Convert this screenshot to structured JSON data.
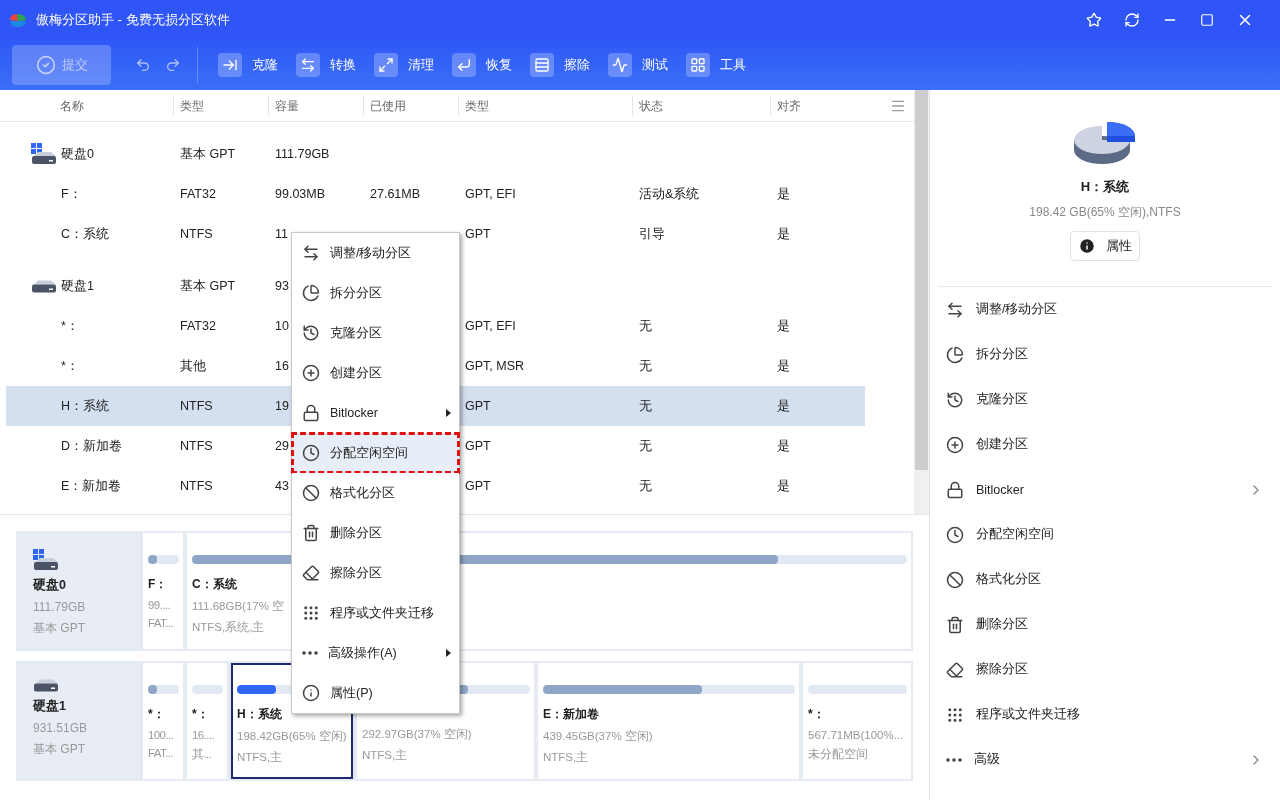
{
  "window": {
    "title": "傲梅分区助手 - 免费无损分区软件"
  },
  "toolbar": {
    "submit": {
      "label": "提交",
      "disabled": true
    },
    "tools": [
      {
        "label": "克隆"
      },
      {
        "label": "转换"
      },
      {
        "label": "清理"
      },
      {
        "label": "恢复"
      },
      {
        "label": "擦除"
      },
      {
        "label": "测试"
      },
      {
        "label": "工具"
      }
    ]
  },
  "table": {
    "columns": [
      "名称",
      "类型",
      "容量",
      "已使用",
      "类型",
      "状态",
      "对齐"
    ],
    "disks": [
      {
        "name": "硬盘0",
        "type": "基本 GPT",
        "capacity": "111.79GB",
        "system": true,
        "children": [
          {
            "name": "F：",
            "type": "FAT32",
            "capacity": "99.03MB",
            "used": "27.61MB",
            "fs": "GPT, EFI",
            "status": "活动&系统",
            "align": "是",
            "selected": false
          },
          {
            "name": "C：系统",
            "type": "NTFS",
            "capacity": "11",
            "fs": "GPT",
            "status": "引导",
            "align": "是",
            "selected": false
          }
        ]
      },
      {
        "name": "硬盘1",
        "type": "基本 GPT",
        "capacity": "93",
        "system": false,
        "children": [
          {
            "name": "*：",
            "type": "FAT32",
            "capacity": "10",
            "fs": "GPT, EFI",
            "status": "无",
            "align": "是",
            "selected": false
          },
          {
            "name": "*：",
            "type": "其他",
            "capacity": "16",
            "fs": "GPT, MSR",
            "status": "无",
            "align": "是",
            "selected": false
          },
          {
            "name": "H：系统",
            "type": "NTFS",
            "capacity": "19",
            "fs": "GPT",
            "status": "无",
            "align": "是",
            "selected": true
          },
          {
            "name": "D：新加卷",
            "type": "NTFS",
            "capacity": "29",
            "fs": "GPT",
            "status": "无",
            "align": "是",
            "selected": false
          },
          {
            "name": "E：新加卷",
            "type": "NTFS",
            "capacity": "43",
            "fs": "GPT",
            "status": "无",
            "align": "是",
            "selected": false
          }
        ]
      }
    ]
  },
  "disk_map": [
    {
      "name": "硬盘0",
      "size": "111.79GB",
      "type": "基本 GPT",
      "system": true,
      "partitions": [
        {
          "label": "F：",
          "size": "99....",
          "fs": "FAT...",
          "level": 0.28,
          "selected": false
        },
        {
          "label": "C：系统",
          "size": "111.68GB(17% 空",
          "fs": "NTFS,系统,主",
          "level": 0.82,
          "selected": false
        }
      ]
    },
    {
      "name": "硬盘1",
      "size": "931.51GB",
      "type": "基本 GPT",
      "system": false,
      "partitions": [
        {
          "label": "*：",
          "size": "100...",
          "fs": "FAT...",
          "level": 0.28,
          "selected": false
        },
        {
          "label": "*：",
          "size": "16....",
          "fs": "其...",
          "level": 0,
          "selected": false
        },
        {
          "label": "H：系统",
          "size": "198.42GB(65% 空闲)",
          "fs": "NTFS,主",
          "level": 0.35,
          "selected": true
        },
        {
          "size": "292.97GB(37% 空闲)",
          "fs": "NTFS,主",
          "level": 0.63,
          "selected": false
        },
        {
          "label": "E：新加卷",
          "size": "439.45GB(37% 空闲)",
          "fs": "NTFS,主",
          "level": 0.63,
          "selected": false
        },
        {
          "label": "*：",
          "size": "567.71MB(100%...",
          "fs": "未分配空间",
          "level": 0,
          "selected": false
        }
      ]
    }
  ],
  "context_menu": [
    {
      "label": "调整/移动分区",
      "submenu": false,
      "selected": false
    },
    {
      "label": "拆分分区",
      "submenu": false,
      "selected": false
    },
    {
      "label": "克隆分区",
      "submenu": false,
      "selected": false
    },
    {
      "label": "创建分区",
      "submenu": false,
      "selected": false
    },
    {
      "label": "Bitlocker",
      "submenu": true,
      "selected": false
    },
    {
      "label": "分配空闲空间",
      "submenu": false,
      "selected": true
    },
    {
      "label": "格式化分区",
      "submenu": false,
      "selected": false
    },
    {
      "label": "删除分区",
      "submenu": false,
      "selected": false
    },
    {
      "label": "擦除分区",
      "submenu": false,
      "selected": false
    },
    {
      "label": "程序或文件夹迁移",
      "submenu": false,
      "selected": false
    },
    {
      "label": "高级操作(A)",
      "submenu": true,
      "selected": false
    },
    {
      "label": "属性(P)",
      "submenu": false,
      "selected": false
    }
  ],
  "details": {
    "title": "H：系统",
    "subtitle": "198.42 GB(65% 空闲),NTFS",
    "button": "属性",
    "actions": [
      {
        "label": "调整/移动分区",
        "submenu": false
      },
      {
        "label": "拆分分区",
        "submenu": false
      },
      {
        "label": "克隆分区",
        "submenu": false
      },
      {
        "label": "创建分区",
        "submenu": false
      },
      {
        "label": "Bitlocker",
        "submenu": true
      },
      {
        "label": "分配空闲空间",
        "submenu": false
      },
      {
        "label": "格式化分区",
        "submenu": false
      },
      {
        "label": "删除分区",
        "submenu": false
      },
      {
        "label": "擦除分区",
        "submenu": false
      },
      {
        "label": "程序或文件夹迁移",
        "submenu": false
      },
      {
        "label": "高级",
        "submenu": true
      }
    ]
  }
}
